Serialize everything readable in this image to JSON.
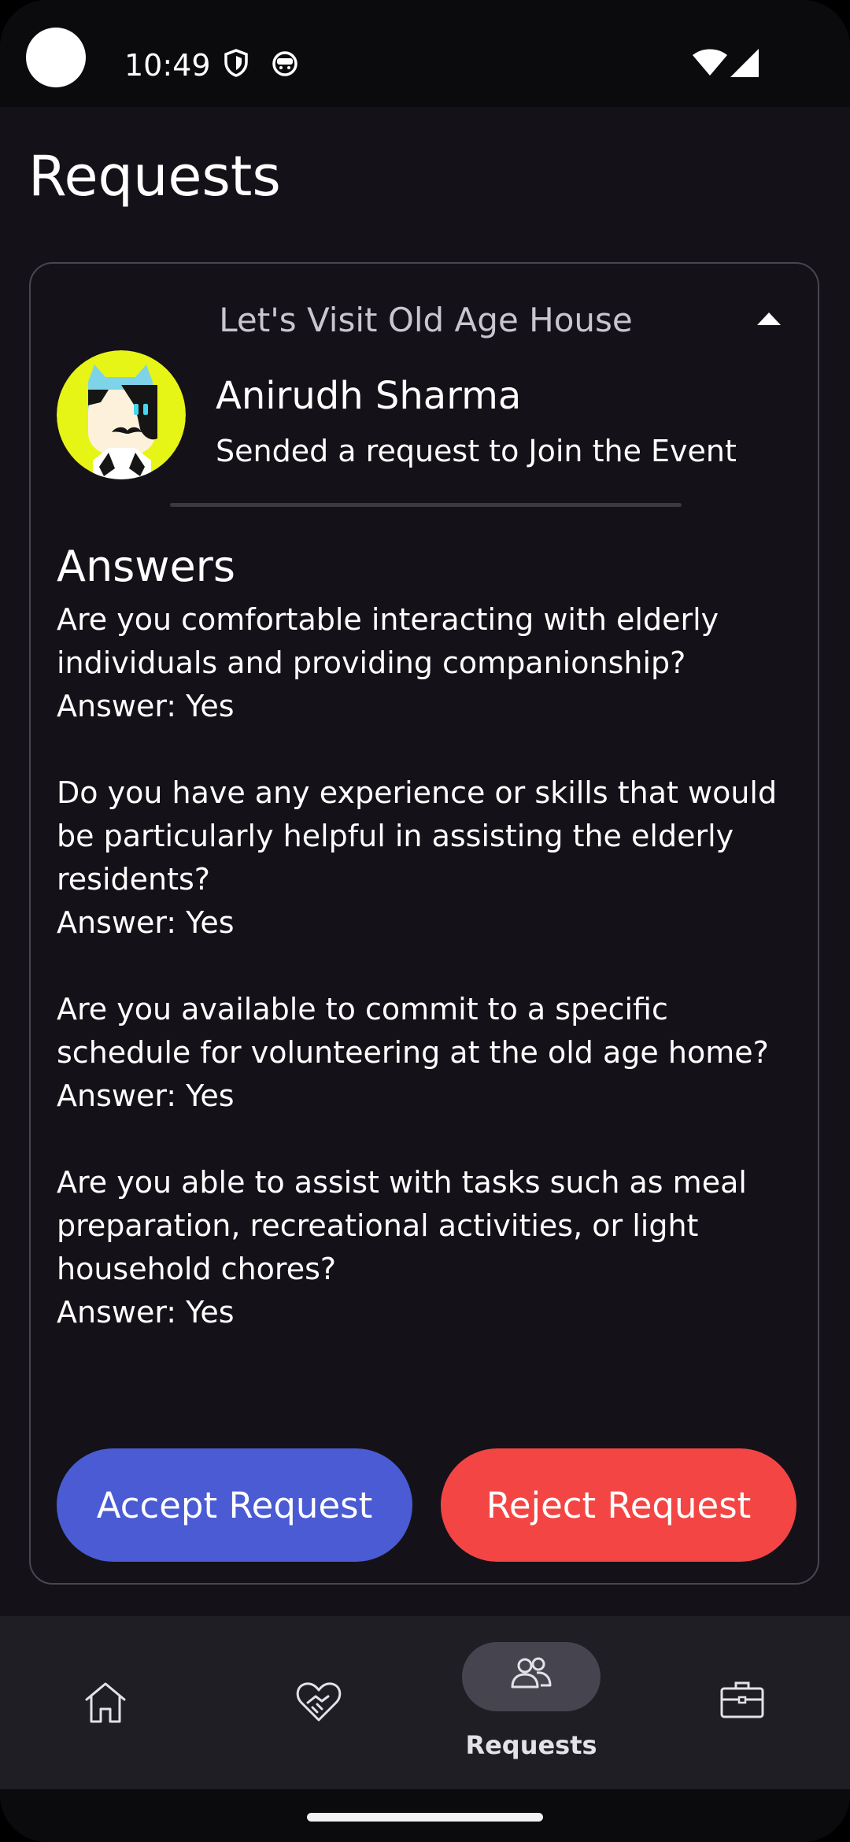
{
  "status_bar": {
    "time": "10:49"
  },
  "page": {
    "title": "Requests"
  },
  "request": {
    "event_title": "Let's Visit Old Age House",
    "requester_name": "Anirudh Sharma",
    "message": "Sended a request to Join the Event",
    "answers_heading": "Answers",
    "qa": [
      {
        "question": "Are you comfortable interacting with elderly individuals and providing companionship?",
        "answer": "Answer: Yes"
      },
      {
        "question": "Do you have any experience or skills that would be particularly helpful in assisting the elderly residents?",
        "answer": "Answer: Yes"
      },
      {
        "question": "Are you available to commit to a specific schedule for volunteering at the old age home?",
        "answer": "Answer: Yes"
      },
      {
        "question": "Are you able to assist with tasks such as meal preparation, recreational activities, or light household chores?",
        "answer": "Answer: Yes"
      }
    ],
    "accept_label": "Accept Request",
    "reject_label": "Reject Request"
  },
  "bottom_nav": {
    "items": [
      {
        "icon": "home-icon",
        "label": ""
      },
      {
        "icon": "volunteer-heart-icon",
        "label": ""
      },
      {
        "icon": "people-icon",
        "label": "Requests",
        "active": true
      },
      {
        "icon": "briefcase-icon",
        "label": ""
      }
    ]
  },
  "colors": {
    "background": "#141218",
    "accept": "#4a5bd4",
    "reject": "#f44545",
    "avatar_bg": "#e6f516"
  }
}
